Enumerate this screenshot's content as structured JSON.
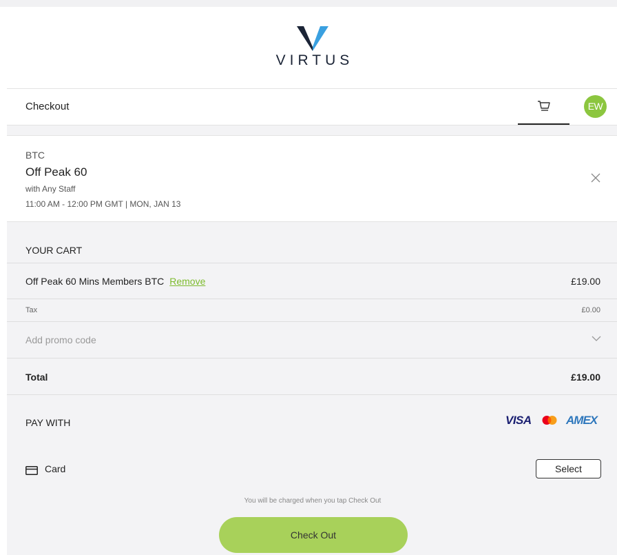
{
  "brand": {
    "name": "VIRTUS"
  },
  "header": {
    "title": "Checkout",
    "avatar_initials": "EW",
    "avatar_color": "#8cc63f"
  },
  "booking": {
    "location": "BTC",
    "service": "Off Peak 60",
    "staff": "with Any Staff",
    "time": "11:00 AM - 12:00 PM GMT | MON, JAN 13"
  },
  "cart": {
    "heading": "YOUR CART",
    "item": {
      "name": "Off Peak 60 Mins Members BTC",
      "remove_label": "Remove",
      "price": "£19.00"
    },
    "tax": {
      "label": "Tax",
      "value": "£0.00"
    },
    "promo_placeholder": "Add promo code",
    "total": {
      "label": "Total",
      "value": "£19.00"
    }
  },
  "payment": {
    "heading": "PAY WITH",
    "card_brands": [
      "VISA",
      "mastercard-icon",
      "AMEX"
    ],
    "method_label": "Card",
    "select_label": "Select",
    "charge_note": "You will be charged when you tap Check Out",
    "checkout_label": "Check Out",
    "accent_color": "#a8d15a",
    "link_color": "#7dbb2d"
  }
}
